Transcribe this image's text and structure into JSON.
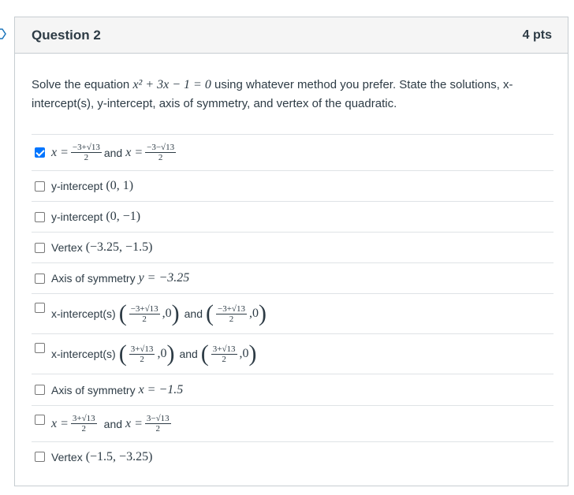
{
  "question": {
    "title": "Question 2",
    "points": "4 pts",
    "prompt_before": "Solve the equation ",
    "prompt_equation": "x² + 3x − 1 = 0",
    "prompt_after": " using whatever method you prefer. State the solutions, x-intercept(s), y-intercept, axis of symmetry, and vertex of the quadratic."
  },
  "answers": [
    {
      "checked": true,
      "label": "x = (−3+√13)/2 and x = (−3−√13)/2",
      "x_eq": "x =",
      "and": "and",
      "x_eq2": "x =",
      "frac1_num": "−3+√13",
      "frac1_den": "2",
      "frac2_num": "−3−√13",
      "frac2_den": "2"
    },
    {
      "checked": false,
      "text": "y-intercept",
      "math": "(0, 1)"
    },
    {
      "checked": false,
      "text": "y-intercept",
      "math": "(0, −1)"
    },
    {
      "checked": false,
      "text": "Vertex",
      "math": "(−3.25, −1.5)"
    },
    {
      "checked": false,
      "text": "Axis of symmetry",
      "math": "y = −3.25"
    },
    {
      "checked": false,
      "text": "x-intercept(s)",
      "and": "and",
      "frac1_num": "−3+√13",
      "frac1_den": "2",
      "frac2_num": "−3+√13",
      "frac2_den": "2",
      "zero": "0"
    },
    {
      "checked": false,
      "text": "x-intercept(s)",
      "and": "and",
      "frac1_num": "3+√13",
      "frac1_den": "2",
      "frac2_num": "3+√13",
      "frac2_den": "2",
      "zero": "0"
    },
    {
      "checked": false,
      "text": "Axis of symmetry",
      "math": "x = −1.5"
    },
    {
      "checked": false,
      "x_eq": "x =",
      "and": "and",
      "x_eq2": "x =",
      "frac1_num": "3+√13",
      "frac1_den": "2",
      "frac2_num": "3−√13",
      "frac2_den": "2"
    },
    {
      "checked": false,
      "text": "Vertex",
      "math": "(−1.5, −3.25)"
    }
  ]
}
